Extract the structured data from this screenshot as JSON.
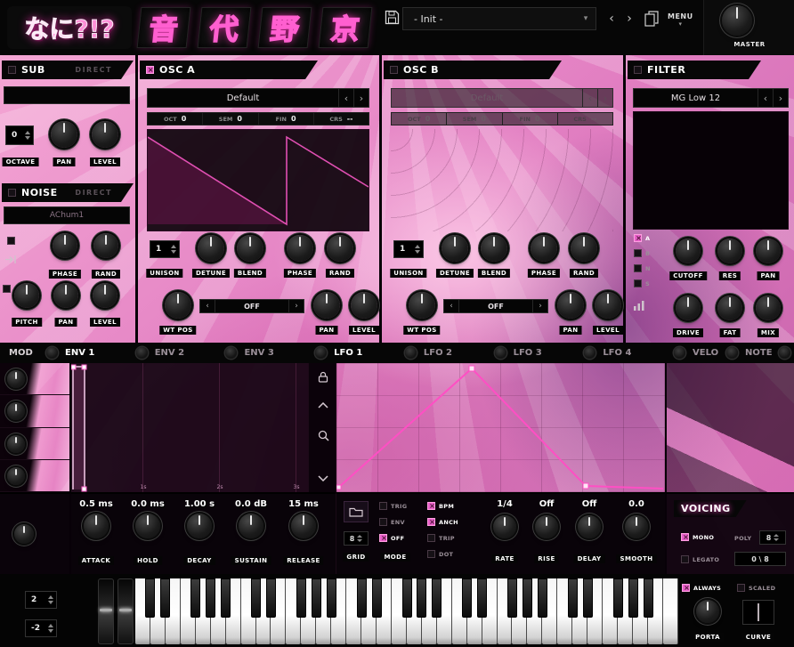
{
  "header": {
    "logo": "なに?!?",
    "kanji": [
      "音",
      "代",
      "野",
      "京"
    ],
    "preset_value": "- Init -",
    "menu_label": "MENU",
    "master_label": "MASTER"
  },
  "sub": {
    "title": "SUB",
    "direct_label": "DIRECT",
    "octave_value": "0",
    "octave_label": "OCTAVE",
    "pan_label": "PAN",
    "level_label": "LEVEL"
  },
  "noise": {
    "title": "NOISE",
    "direct_label": "DIRECT",
    "preset": "AChum1",
    "phase_label": "PHASE",
    "rand_label": "RAND",
    "pitch_label": "PITCH",
    "pan_label": "PAN",
    "level_label": "LEVEL"
  },
  "osc_a": {
    "title": "OSC A",
    "preset": "Default",
    "cells": [
      {
        "l": "OCT",
        "v": "0"
      },
      {
        "l": "SEM",
        "v": "0"
      },
      {
        "l": "FIN",
        "v": "0"
      },
      {
        "l": "CRS",
        "v": "--"
      }
    ],
    "unison_value": "1",
    "unison_label": "UNISON",
    "detune_label": "DETUNE",
    "blend_label": "BLEND",
    "phase_label": "PHASE",
    "rand_label": "RAND",
    "wtpos_label": "WT POS",
    "mode_value": "OFF",
    "pan_label": "PAN",
    "level_label": "LEVEL"
  },
  "osc_b": {
    "title": "OSC B",
    "preset": "Default",
    "cells": [
      {
        "l": "OCT",
        "v": "0"
      },
      {
        "l": "SEM",
        "v": "0"
      },
      {
        "l": "FIN",
        "v": "0"
      },
      {
        "l": "CRS",
        "v": "--"
      }
    ],
    "unison_value": "1",
    "unison_label": "UNISON",
    "detune_label": "DETUNE",
    "blend_label": "BLEND",
    "phase_label": "PHASE",
    "rand_label": "RAND",
    "wtpos_label": "WT POS",
    "mode_value": "OFF",
    "pan_label": "PAN",
    "level_label": "LEVEL"
  },
  "filter": {
    "title": "FILTER",
    "preset": "MG Low 12",
    "inputs": [
      {
        "label": "A",
        "checked": true
      },
      {
        "label": "B",
        "checked": false
      },
      {
        "label": "N",
        "checked": false
      },
      {
        "label": "S",
        "checked": false
      }
    ],
    "cutoff_label": "CUTOFF",
    "res_label": "RES",
    "pan_label": "PAN",
    "drive_label": "DRIVE",
    "fat_label": "FAT",
    "mix_label": "MIX"
  },
  "mod_tabs": [
    {
      "label": "MOD",
      "active": false
    },
    {
      "label": "ENV 1",
      "active": true
    },
    {
      "label": "ENV 2",
      "active": false
    },
    {
      "label": "ENV 3",
      "active": false
    },
    {
      "label": "LFO 1",
      "active": true
    },
    {
      "label": "LFO 2",
      "active": false
    },
    {
      "label": "LFO 3",
      "active": false
    },
    {
      "label": "LFO 4",
      "active": false
    },
    {
      "label": "VELO",
      "active": false
    },
    {
      "label": "NOTE",
      "active": false
    }
  ],
  "envelope": {
    "time_labels": [
      "1s",
      "2s",
      "3s"
    ],
    "params": [
      {
        "value": "0.5 ms",
        "label": "ATTACK"
      },
      {
        "value": "0.0 ms",
        "label": "HOLD"
      },
      {
        "value": "1.00 s",
        "label": "DECAY"
      },
      {
        "value": "0.0 dB",
        "label": "SUSTAIN"
      },
      {
        "value": "15 ms",
        "label": "RELEASE"
      }
    ]
  },
  "lfo": {
    "grid_value": "8",
    "grid_label": "GRID",
    "mode_label": "MODE",
    "switches_a": [
      {
        "label": "TRIG",
        "checked": false
      },
      {
        "label": "ENV",
        "checked": false
      },
      {
        "label": "OFF",
        "checked": true
      }
    ],
    "switches_b": [
      {
        "label": "BPM",
        "checked": true
      },
      {
        "label": "ANCH",
        "checked": true
      },
      {
        "label": "TRIP",
        "checked": false
      },
      {
        "label": "DOT",
        "checked": false
      }
    ],
    "params": [
      {
        "value": "1/4",
        "label": "RATE"
      },
      {
        "value": "Off",
        "label": "RISE"
      },
      {
        "value": "Off",
        "label": "DELAY"
      },
      {
        "value": "0.0",
        "label": "SMOOTH"
      }
    ]
  },
  "voicing": {
    "title": "VOICING",
    "mono_label": "MONO",
    "mono_checked": true,
    "legato_label": "LEGATO",
    "legato_checked": false,
    "poly_label": "POLY",
    "poly_value": "8",
    "counter": "0 \\ 8"
  },
  "bottom": {
    "bend_up": "2",
    "bend_down": "-2",
    "always_label": "ALWAYS",
    "always_checked": true,
    "scaled_label": "SCALED",
    "scaled_checked": false,
    "porta_label": "PORTA",
    "curve_label": "CURVE"
  },
  "colors": {
    "accent": "#ff5fd0",
    "check_on": "#e85ec8"
  }
}
